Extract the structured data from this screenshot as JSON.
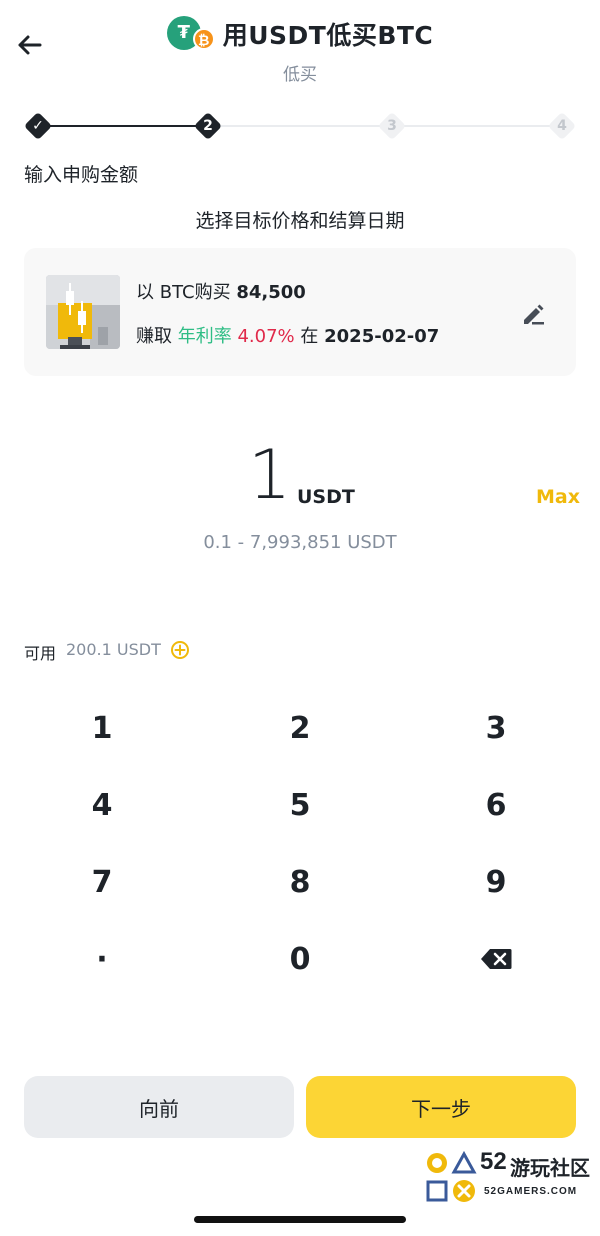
{
  "header": {
    "title": "用USDT低买BTC",
    "subtitle": "低买",
    "coin_a_glyph": "₮",
    "coin_b_glyph": "₿"
  },
  "stepper": {
    "steps": [
      {
        "label": "✓",
        "state": "done"
      },
      {
        "label": "2",
        "state": "active"
      },
      {
        "label": "3",
        "state": "todo"
      },
      {
        "label": "4",
        "state": "todo"
      }
    ]
  },
  "section": {
    "label": "输入申购金额",
    "heading": "选择目标价格和结算日期"
  },
  "target_card": {
    "buy_prefix": "以 BTC购买",
    "target_price": "84,500",
    "earn_label": "赚取",
    "apr_label": "年利率",
    "apr_value": "4.07%",
    "on_label": "在",
    "settle_date": "2025-02-07"
  },
  "amount": {
    "value": "1",
    "unit": "USDT",
    "max_label": "Max",
    "range": "0.1 - 7,993,851 USDT"
  },
  "available": {
    "label": "可用",
    "value": "200.1 USDT"
  },
  "keypad": {
    "keys": [
      "1",
      "2",
      "3",
      "4",
      "5",
      "6",
      "7",
      "8",
      "9",
      "·",
      "0",
      "⌫"
    ]
  },
  "buttons": {
    "back": "向前",
    "next": "下一步"
  },
  "watermark": {
    "number": "52",
    "name": "游玩社区",
    "url": "52GAMERS.COM"
  },
  "colors": {
    "accent": "#fcd535",
    "max": "#f0b90b",
    "green": "#2ebd85",
    "red": "#e0294a",
    "text": "#1e2329",
    "muted": "#848e9c"
  }
}
